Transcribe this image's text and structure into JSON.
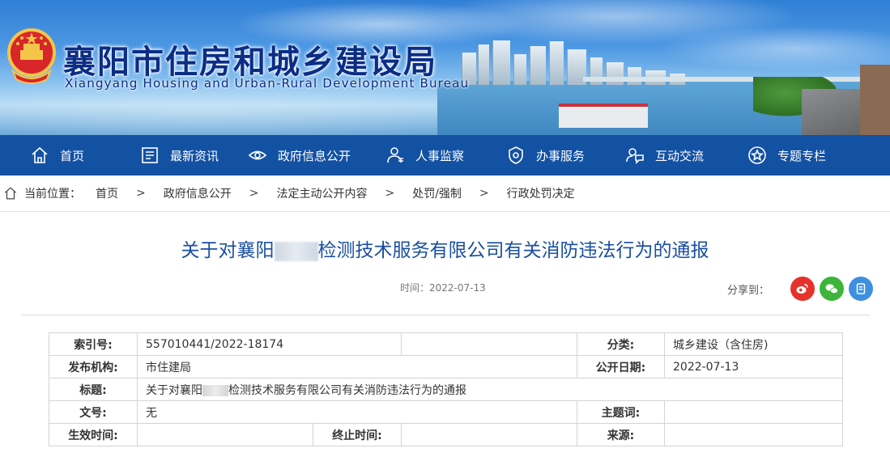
{
  "header": {
    "title_cn": "襄阳市住房和城乡建设局",
    "title_en": "Xiangyang Housing and Urban-Rural Development Bureau",
    "emblem_icon": "national-emblem-icon"
  },
  "nav": {
    "items": [
      {
        "label": "首页",
        "icon": "home-icon"
      },
      {
        "label": "最新资讯",
        "icon": "news-icon"
      },
      {
        "label": "政府信息公开",
        "icon": "eye-icon"
      },
      {
        "label": "人事监察",
        "icon": "person-icon"
      },
      {
        "label": "办事服务",
        "icon": "service-icon"
      },
      {
        "label": "互动交流",
        "icon": "chat-icon"
      },
      {
        "label": "专题专栏",
        "icon": "star-icon"
      }
    ]
  },
  "breadcrumb": {
    "prefix": "当前位置：",
    "items": [
      "首页",
      "政府信息公开",
      "法定主动公开内容",
      "处罚/强制",
      "行政处罚决定"
    ],
    "separator": ">"
  },
  "article": {
    "title_before": "关于对襄阳",
    "title_after": "检测技术服务有限公司有关消防违法行为的通报",
    "time_label": "时间：",
    "time_value": "2022-07-13",
    "share_label": "分享到："
  },
  "info_table": {
    "index_no_label": "索引号:",
    "index_no": "557010441/2022-18174",
    "category_label": "分类:",
    "category": "城乡建设（含住房)",
    "publisher_label": "发布机构:",
    "publisher": "市住建局",
    "public_date_label": "公开日期:",
    "public_date": "2022-07-13",
    "title_label": "标题:",
    "title_before": "关于对襄阳",
    "title_after": "检测技术服务有限公司有关消防违法行为的通报",
    "doc_no_label": "文号:",
    "doc_no": "无",
    "subject_label": "主题词:",
    "subject": "",
    "effective_label": "生效时间:",
    "effective": "",
    "end_label": "终止时间:",
    "end": "",
    "source_label": "来源:",
    "source": ""
  },
  "colors": {
    "nav_bg": "#1351a3",
    "title_blue": "#1a4fa0",
    "weibo": "#e6322a",
    "wechat": "#3db53a",
    "qzone": "#3f8fe0"
  }
}
